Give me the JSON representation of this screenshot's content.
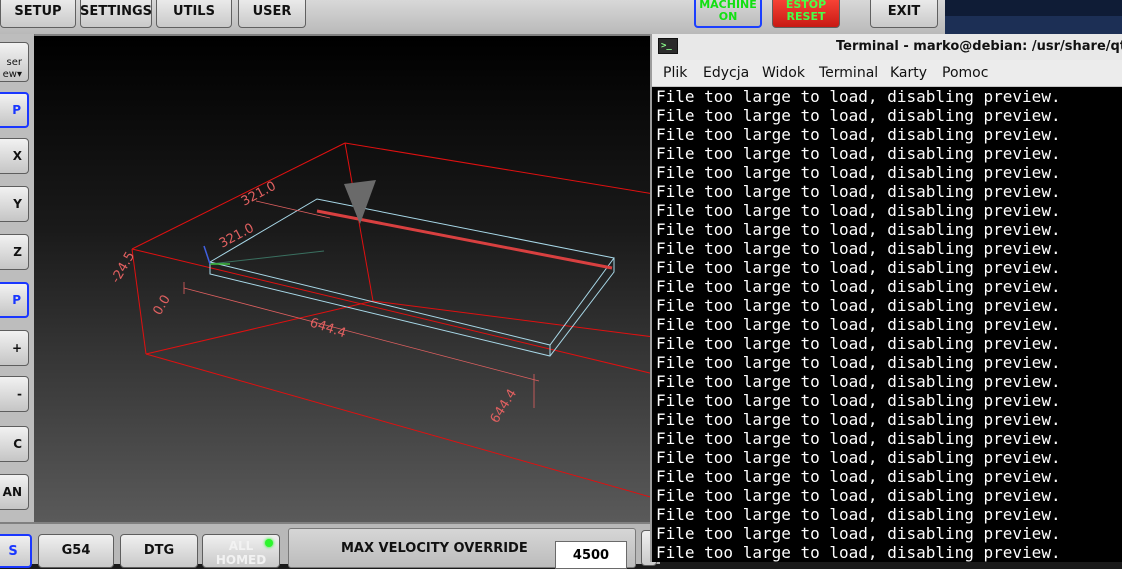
{
  "toolbar": {
    "setup": "SETUP",
    "settings": "SETTINGS",
    "utils": "UTILS",
    "user": "USER",
    "machine_line1": "MACHINE",
    "machine_line2": "ON",
    "estop_line1": "ESTOP",
    "estop_line2": "RESET",
    "exit": "EXIT"
  },
  "sidebar": {
    "view_line1": "ser",
    "view_line2": "ew",
    "buttons": [
      "P",
      "X",
      "Y",
      "Z",
      "P",
      "+",
      "-",
      "C",
      "AN"
    ]
  },
  "viewport": {
    "dims": [
      "321.0",
      "321.0",
      "644.4",
      "644.4",
      "0.0",
      "-24.5"
    ]
  },
  "bottombar": {
    "btn1": "S",
    "g54": "G54",
    "dtg": "DTG",
    "homed_line1": "ALL",
    "homed_line2": "HOMED",
    "velocity_label": "MAX VELOCITY OVERRIDE",
    "velocity_value": "4500"
  },
  "terminal": {
    "title": "Terminal - marko@debian: /usr/share/qtvcp",
    "menu": [
      "Plik",
      "Edycja",
      "Widok",
      "Terminal",
      "Karty",
      "Pomoc"
    ],
    "line": "File too large to load, disabling preview.",
    "line_count": 25
  },
  "colors": {
    "machine_text": "#12e012",
    "estop_bg": "#e0281e",
    "selected_border": "#1a37ff",
    "limit_box": "#e01010",
    "stock_box": "#a8d8e8"
  }
}
